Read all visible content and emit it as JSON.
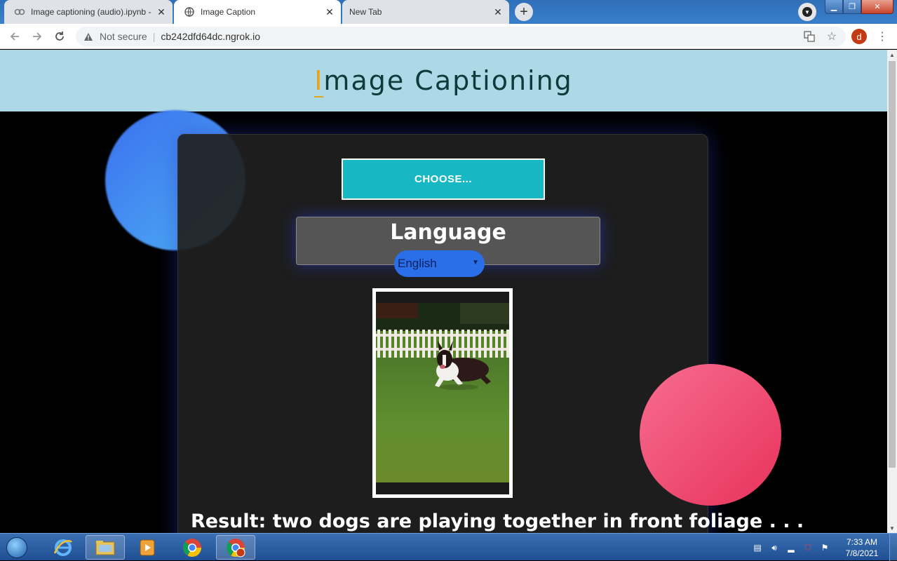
{
  "browser": {
    "tabs": [
      {
        "label": "Image captioning (audio).ipynb - ",
        "active": false
      },
      {
        "label": "Image Caption",
        "active": true
      },
      {
        "label": "New Tab",
        "active": false
      }
    ],
    "security_label": "Not secure",
    "url": "cb242dfd64dc.ngrok.io",
    "profile_initial": "d"
  },
  "page": {
    "title_first_letter": "I",
    "title_rest": "mage Captioning",
    "choose_button": "CHOOSE...",
    "language_label": "Language",
    "language_selected": "English",
    "result_text": "Result: two dogs are playing together in front foliage . . ."
  },
  "taskbar": {
    "time": "7:33 AM",
    "date": "7/8/2021"
  },
  "colors": {
    "header_bg": "#add8e6",
    "accent_letter": "#e8a21c",
    "choose_button": "#17b8c4",
    "select_bg": "#2a6fe8"
  }
}
